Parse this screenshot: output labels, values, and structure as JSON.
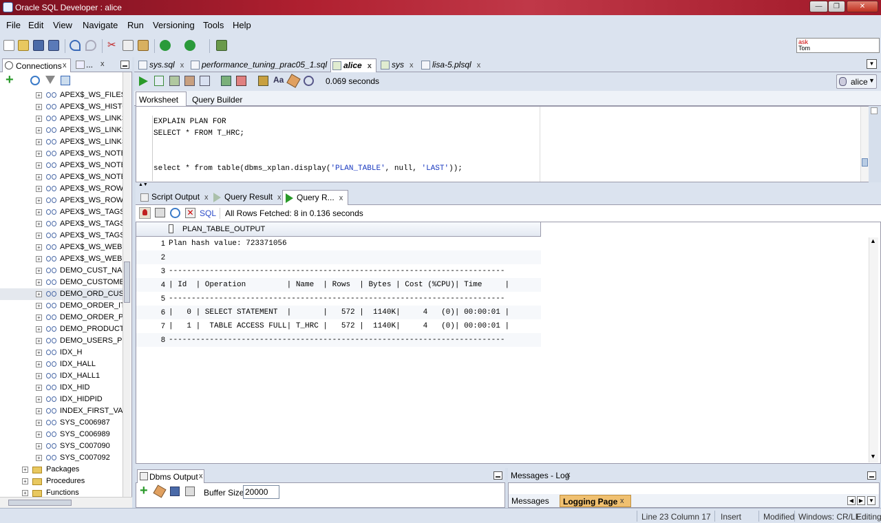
{
  "window": {
    "title": "Oracle SQL Developer : alice",
    "buttons": [
      "—",
      "❐",
      "✕"
    ]
  },
  "menu": [
    "File",
    "Edit",
    "View",
    "Navigate",
    "Run",
    "Versioning",
    "Tools",
    "Help"
  ],
  "ask": {
    "line1": "ask",
    "line2": "Tom"
  },
  "left_panel": {
    "tabs": [
      {
        "label": "Connections",
        "close": "x"
      },
      {
        "label": "...",
        "close": "x"
      }
    ],
    "tree_items": [
      "APEX$_WS_FILES_",
      "APEX$_WS_HISTO",
      "APEX$_WS_LINKS_",
      "APEX$_WS_LINKS_",
      "APEX$_WS_LINKS_",
      "APEX$_WS_NOTES",
      "APEX$_WS_NOTES",
      "APEX$_WS_NOTES",
      "APEX$_WS_ROWS",
      "APEX$_WS_ROWS",
      "APEX$_WS_TAGS_",
      "APEX$_WS_TAGS_",
      "APEX$_WS_TAGS_",
      "APEX$_WS_WEBPG",
      "APEX$_WS_WEBPG",
      "DEMO_CUST_NAM",
      "DEMO_CUSTOMER",
      "DEMO_ORD_CUST",
      "DEMO_ORDER_ITE",
      "DEMO_ORDER_PK",
      "DEMO_PRODUCT_",
      "DEMO_USERS_PK",
      "IDX_H",
      "IDX_HALL",
      "IDX_HALL1",
      "IDX_HID",
      "IDX_HIDPID",
      "INDEX_FIRST_VAL",
      "SYS_C006987",
      "SYS_C006989",
      "SYS_C007090",
      "SYS_C007092"
    ],
    "folders": [
      "Packages",
      "Procedures",
      "Functions"
    ]
  },
  "doc_tabs": [
    {
      "label": "sys.sql",
      "close": "x"
    },
    {
      "label": "performance_tuning_prac05_1.sql",
      "close": "x"
    },
    {
      "label": "alice",
      "close": "x"
    },
    {
      "label": "sys",
      "close": "x"
    },
    {
      "label": "lisa-5.plsql",
      "close": "x"
    }
  ],
  "worksheet": {
    "timing": "0.069 seconds",
    "connection": "alice",
    "tabs": [
      "Worksheet",
      "Query Builder"
    ],
    "lines": [
      {
        "text": "EXPLAIN PLAN FOR"
      },
      {
        "text": "SELECT * FROM T_HRC;"
      },
      {
        "text": ""
      },
      {
        "text": ""
      },
      {
        "text": "select * from table(dbms_xplan.display('PLAN_TABLE', null, 'LAST'));"
      }
    ]
  },
  "result_tabs": [
    {
      "label": "Script Output",
      "close": "x"
    },
    {
      "label": "Query Result",
      "close": "x"
    },
    {
      "label": "Query R...",
      "close": "x"
    }
  ],
  "results": {
    "sql_label": "SQL",
    "status": "All Rows Fetched: 8 in 0.136 seconds",
    "column": "PLAN_TABLE_OUTPUT",
    "rows": [
      {
        "n": "1",
        "v": "Plan hash value: 723371056"
      },
      {
        "n": "2",
        "v": ""
      },
      {
        "n": "3",
        "v": "--------------------------------------------------------------------------"
      },
      {
        "n": "4",
        "v": "| Id  | Operation         | Name  | Rows  | Bytes | Cost (%CPU)| Time     |"
      },
      {
        "n": "5",
        "v": "--------------------------------------------------------------------------"
      },
      {
        "n": "6",
        "v": "|   0 | SELECT STATEMENT  |       |   572 |  1140K|     4   (0)| 00:00:01 |"
      },
      {
        "n": "7",
        "v": "|   1 |  TABLE ACCESS FULL| T_HRC |   572 |  1140K|     4   (0)| 00:00:01 |"
      },
      {
        "n": "8",
        "v": "--------------------------------------------------------------------------"
      }
    ]
  },
  "dbms": {
    "title": "Dbms Output",
    "close": "x",
    "buffer_label": "Buffer Size:",
    "buffer_value": "20000"
  },
  "messages": {
    "title": "Messages - Log",
    "close": "x",
    "tabs": [
      {
        "label": "Messages"
      },
      {
        "label": "Logging Page",
        "close": "x"
      }
    ]
  },
  "status": {
    "position": "Line 23 Column 17",
    "mode": "Insert",
    "modified": "Modified",
    "eol": "Windows: CR/LF",
    "state": "Editing"
  }
}
